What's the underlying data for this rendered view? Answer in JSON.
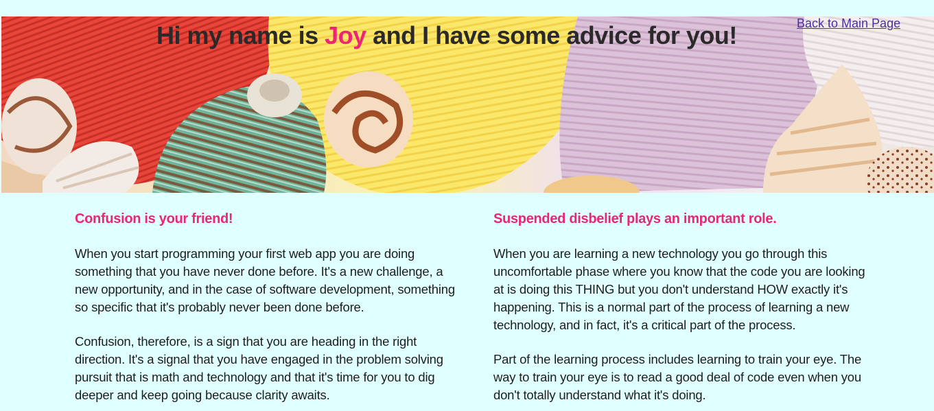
{
  "header": {
    "title_before": "Hi my name is ",
    "title_name": "Joy",
    "title_after": " and I have some advice for you!",
    "back_link": "Back to Main Page"
  },
  "colors": {
    "background": "#e0ffff",
    "accent": "#ee2478",
    "link": "#4b2fa3"
  },
  "sections": [
    {
      "heading": "Confusion is your friend!",
      "paragraphs": [
        "When you start programming your first web app you are doing something that you have never done before. It's a new challenge, a new opportunity, and in the case of software development, something so specific that it's probably never been done before.",
        "Confusion, therefore, is a sign that you are heading in the right direction. It's a signal that you have engaged in the problem solving pursuit that is math and technology and that it's time for you to dig deeper and keep going because clarity awaits."
      ]
    },
    {
      "heading": "Suspended disbelief plays an important role.",
      "paragraphs": [
        "When you are learning a new technology you go through this uncomfortable phase where you know that the code you are looking at is doing this THING but you don't understand HOW exactly it's happening. This is a normal part of the process of learning a new technology, and in fact, it's a critical part of the process.",
        "Part of the learning process includes learning to train your eye. The way to train your eye is to read a good deal of code even when you don't totally understand what it's doing."
      ]
    }
  ]
}
